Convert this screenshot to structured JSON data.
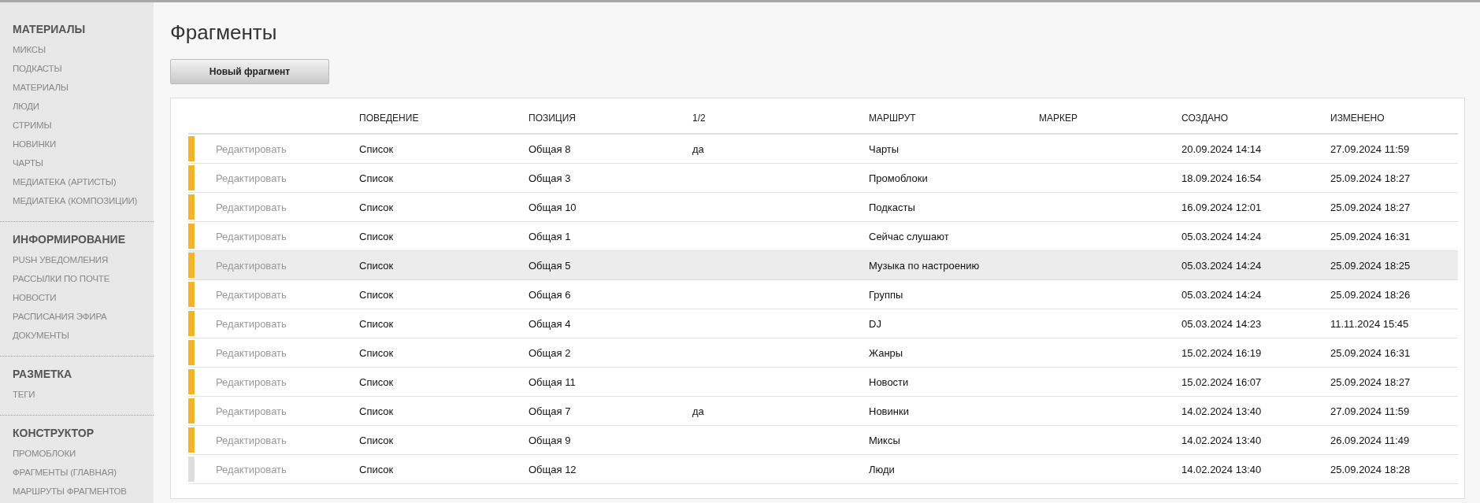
{
  "sidebar": {
    "sections": [
      {
        "title": "МАТЕРИАЛЫ",
        "items": [
          "МИКСЫ",
          "ПОДКАСТЫ",
          "МАТЕРИАЛЫ",
          "ЛЮДИ",
          "СТРИМЫ",
          "НОВИНКИ",
          "ЧАРТЫ",
          "МЕДИАТЕКА (АРТИСТЫ)",
          "МЕДИАТЕКА (КОМПОЗИЦИИ)"
        ]
      },
      {
        "title": "ИНФОРМИРОВАНИЕ",
        "items": [
          "PUSH УВЕДОМЛЕНИЯ",
          "РАССЫЛКИ ПО ПОЧТЕ",
          "НОВОСТИ",
          "РАСПИСАНИЯ ЭФИРА",
          "ДОКУМЕНТЫ"
        ]
      },
      {
        "title": "РАЗМЕТКА",
        "items": [
          "ТЕГИ"
        ]
      },
      {
        "title": "КОНСТРУКТОР",
        "items": [
          "ПРОМОБЛОКИ",
          "ФРАГМЕНТЫ (ГЛАВНАЯ)",
          "МАРШРУТЫ ФРАГМЕНТОВ"
        ]
      }
    ]
  },
  "page": {
    "title": "Фрагменты",
    "new_button": "Новый фрагмент"
  },
  "table": {
    "columns": [
      "ПОВЕДЕНИЕ",
      "ПОЗИЦИЯ",
      "1/2",
      "МАРШРУТ",
      "МАРКЕР",
      "СОЗДАНО",
      "ИЗМЕНЕНО"
    ],
    "rows": [
      {
        "color": "#f2b526",
        "highlighted": false,
        "edit": "Редактировать",
        "behavior": "Список",
        "position": "Общая 8",
        "half": "да",
        "route": "Чарты",
        "created": "20.09.2024 14:14",
        "modified": "27.09.2024 11:59"
      },
      {
        "color": "#f2b526",
        "highlighted": false,
        "edit": "Редактировать",
        "behavior": "Список",
        "position": "Общая 3",
        "route": "Промоблоки",
        "created": "18.09.2024 16:54",
        "modified": "25.09.2024 18:27"
      },
      {
        "color": "#f2b526",
        "highlighted": false,
        "edit": "Редактировать",
        "behavior": "Список",
        "position": "Общая 10",
        "route": "Подкасты",
        "created": "16.09.2024 12:01",
        "modified": "25.09.2024 18:27"
      },
      {
        "color": "#f2b526",
        "highlighted": false,
        "edit": "Редактировать",
        "behavior": "Список",
        "position": "Общая 1",
        "route": "Сейчас слушают",
        "created": "05.03.2024 14:24",
        "modified": "25.09.2024 16:31"
      },
      {
        "color": "#f2b526",
        "highlighted": true,
        "edit": "Редактировать",
        "behavior": "Список",
        "position": "Общая 5",
        "route": "Музыка по настроению",
        "created": "05.03.2024 14:24",
        "modified": "25.09.2024 18:25"
      },
      {
        "color": "#f2b526",
        "highlighted": false,
        "edit": "Редактировать",
        "behavior": "Список",
        "position": "Общая 6",
        "route": "Группы",
        "created": "05.03.2024 14:24",
        "modified": "25.09.2024 18:26"
      },
      {
        "color": "#f2b526",
        "highlighted": false,
        "edit": "Редактировать",
        "behavior": "Список",
        "position": "Общая 4",
        "route": "DJ",
        "created": "05.03.2024 14:23",
        "modified": "11.11.2024 15:45"
      },
      {
        "color": "#f2b526",
        "highlighted": false,
        "edit": "Редактировать",
        "behavior": "Список",
        "position": "Общая 2",
        "route": "Жанры",
        "created": "15.02.2024 16:19",
        "modified": "25.09.2024 16:31"
      },
      {
        "color": "#f2b526",
        "highlighted": false,
        "edit": "Редактировать",
        "behavior": "Список",
        "position": "Общая 11",
        "route": "Новости",
        "created": "15.02.2024 16:07",
        "modified": "25.09.2024 18:27"
      },
      {
        "color": "#f2b526",
        "highlighted": false,
        "edit": "Редактировать",
        "behavior": "Список",
        "position": "Общая 7",
        "half": "да",
        "route": "Новинки",
        "created": "14.02.2024 13:40",
        "modified": "27.09.2024 11:59"
      },
      {
        "color": "#f2b526",
        "highlighted": false,
        "edit": "Редактировать",
        "behavior": "Список",
        "position": "Общая 9",
        "route": "Миксы",
        "created": "14.02.2024 13:40",
        "modified": "26.09.2024 11:49"
      },
      {
        "color": "#dddddd",
        "highlighted": false,
        "edit": "Редактировать",
        "behavior": "Список",
        "position": "Общая 12",
        "route": "Люди",
        "created": "14.02.2024 13:40",
        "modified": "25.09.2024 18:28"
      }
    ]
  }
}
